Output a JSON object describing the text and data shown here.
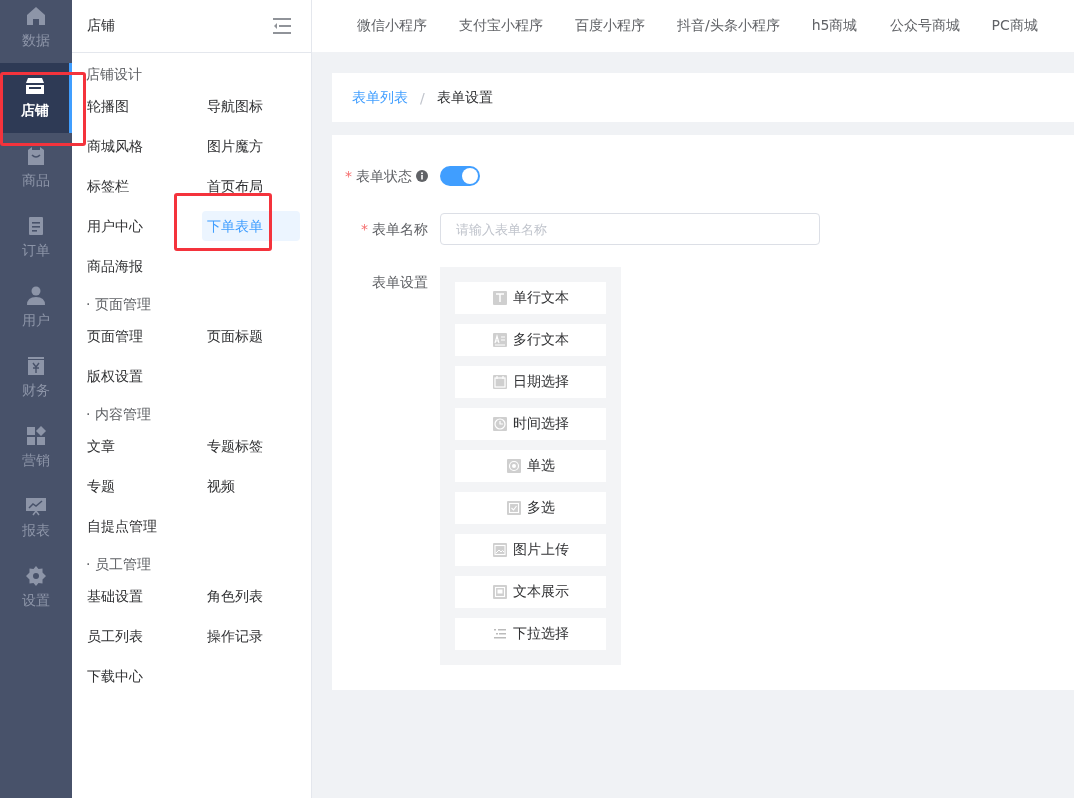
{
  "nav_rail": [
    {
      "label": "数据",
      "selected": false,
      "highlighted": false
    },
    {
      "label": "店铺",
      "selected": true,
      "highlighted": true
    },
    {
      "label": "商品",
      "selected": false,
      "highlighted": false
    },
    {
      "label": "订单",
      "selected": false,
      "highlighted": false
    },
    {
      "label": "用户",
      "selected": false,
      "highlighted": false
    },
    {
      "label": "财务",
      "selected": false,
      "highlighted": false
    },
    {
      "label": "营销",
      "selected": false,
      "highlighted": false
    },
    {
      "label": "报表",
      "selected": false,
      "highlighted": false
    },
    {
      "label": "设置",
      "selected": false,
      "highlighted": false
    }
  ],
  "submenu": {
    "title": "店铺",
    "sections": [
      {
        "title": "店铺设计",
        "items": [
          {
            "label": "轮播图",
            "selected": false,
            "highlighted": false
          },
          {
            "label": "导航图标",
            "selected": false,
            "highlighted": false
          },
          {
            "label": "商城风格",
            "selected": false,
            "highlighted": false
          },
          {
            "label": "图片魔方",
            "selected": false,
            "highlighted": false
          },
          {
            "label": "标签栏",
            "selected": false,
            "highlighted": false
          },
          {
            "label": "首页布局",
            "selected": false,
            "highlighted": false
          },
          {
            "label": "用户中心",
            "selected": false,
            "highlighted": false
          },
          {
            "label": "下单表单",
            "selected": true,
            "highlighted": true
          },
          {
            "label": "商品海报",
            "selected": false,
            "highlighted": false
          }
        ]
      },
      {
        "title": "· 页面管理",
        "items": [
          {
            "label": "页面管理",
            "selected": false,
            "highlighted": false
          },
          {
            "label": "页面标题",
            "selected": false,
            "highlighted": false
          },
          {
            "label": "版权设置",
            "selected": false,
            "highlighted": false
          }
        ]
      },
      {
        "title": "· 内容管理",
        "items": [
          {
            "label": "文章",
            "selected": false,
            "highlighted": false
          },
          {
            "label": "专题标签",
            "selected": false,
            "highlighted": false
          },
          {
            "label": "专题",
            "selected": false,
            "highlighted": false
          },
          {
            "label": "视频",
            "selected": false,
            "highlighted": false
          },
          {
            "label": "自提点管理",
            "selected": false,
            "highlighted": false
          }
        ]
      },
      {
        "title": "· 员工管理",
        "items": [
          {
            "label": "基础设置",
            "selected": false,
            "highlighted": false
          },
          {
            "label": "角色列表",
            "selected": false,
            "highlighted": false
          },
          {
            "label": "员工列表",
            "selected": false,
            "highlighted": false
          },
          {
            "label": "操作记录",
            "selected": false,
            "highlighted": false
          }
        ]
      },
      {
        "items": [
          {
            "label": "下载中心",
            "selected": false,
            "highlighted": false
          }
        ]
      }
    ]
  },
  "top_tabs": [
    "微信小程序",
    "支付宝小程序",
    "百度小程序",
    "抖音/头条小程序",
    "h5商城",
    "公众号商城",
    "PC商城"
  ],
  "breadcrumb": {
    "items": [
      "表单列表",
      "表单设置"
    ],
    "separator": "/"
  },
  "form": {
    "required_mark": "*",
    "status": {
      "label": "表单状态",
      "required": true,
      "on": true
    },
    "name": {
      "label": "表单名称",
      "required": true,
      "placeholder": "请输入表单名称"
    },
    "settings": {
      "label": "表单设置",
      "fields": [
        {
          "kind": "text",
          "label": "单行文本"
        },
        {
          "kind": "textarea",
          "label": "多行文本"
        },
        {
          "kind": "date",
          "label": "日期选择"
        },
        {
          "kind": "time",
          "label": "时间选择"
        },
        {
          "kind": "radio",
          "label": "单选"
        },
        {
          "kind": "checkbox",
          "label": "多选"
        },
        {
          "kind": "image",
          "label": "图片上传"
        },
        {
          "kind": "display",
          "label": "文本展示"
        },
        {
          "kind": "select",
          "label": "下拉选择"
        }
      ]
    }
  }
}
